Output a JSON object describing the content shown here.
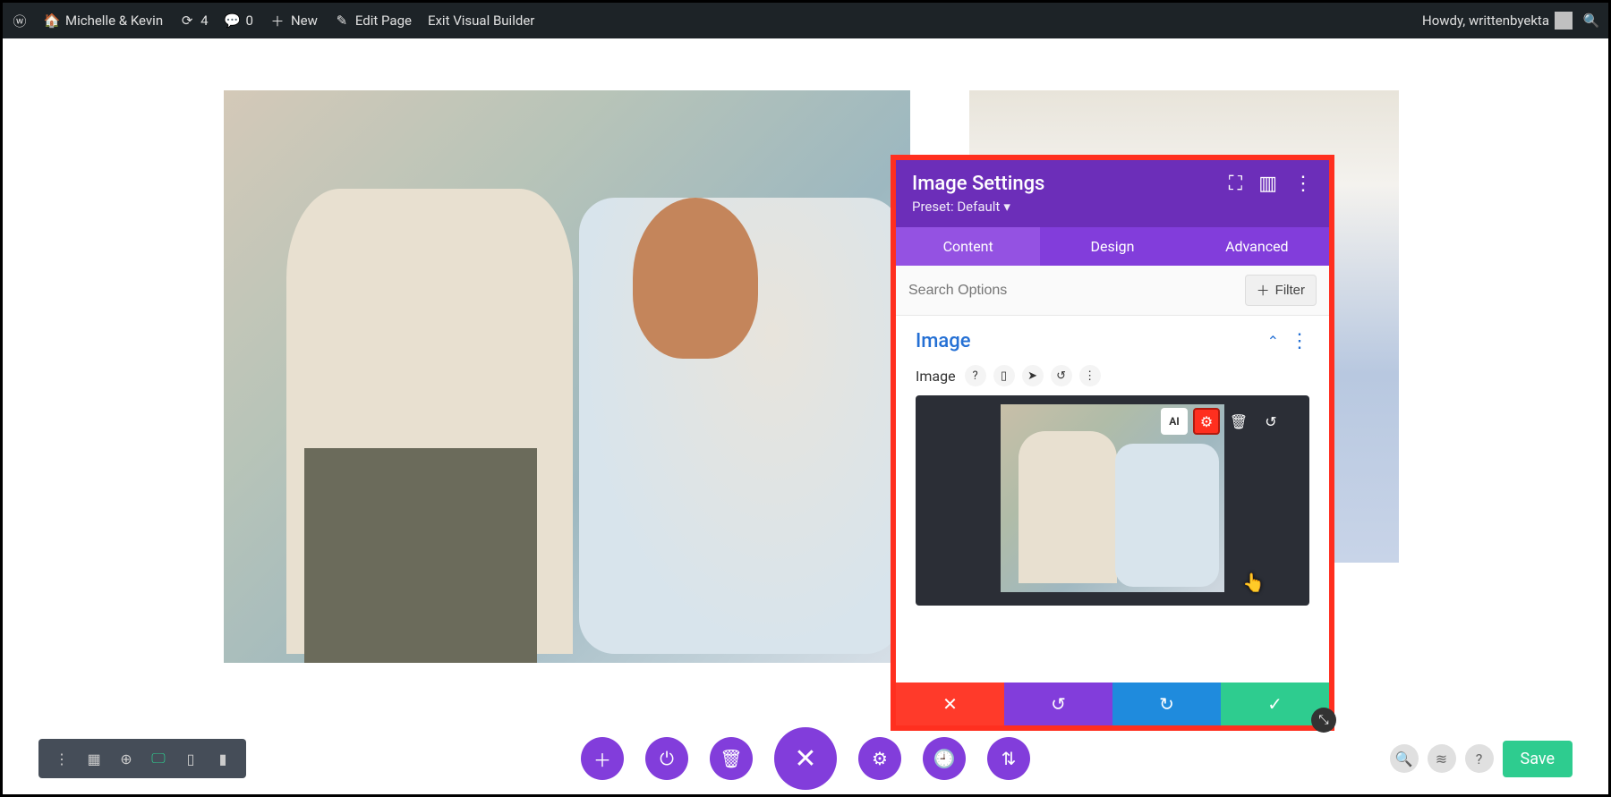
{
  "wp_bar": {
    "site_name": "Michelle & Kevin",
    "updates_count": "4",
    "comments_count": "0",
    "new_label": "New",
    "edit_page_label": "Edit Page",
    "exit_vb_label": "Exit Visual Builder",
    "howdy": "Howdy, writtenbyekta"
  },
  "panel": {
    "title": "Image Settings",
    "preset_label": "Preset: Default",
    "tabs": {
      "content": "Content",
      "design": "Design",
      "advanced": "Advanced"
    },
    "search_placeholder": "Search Options",
    "filter_label": "Filter",
    "section_title": "Image",
    "field_label": "Image",
    "thumb_toolbar": {
      "ai": "AI"
    }
  },
  "divi_bar": {
    "save_label": "Save"
  }
}
